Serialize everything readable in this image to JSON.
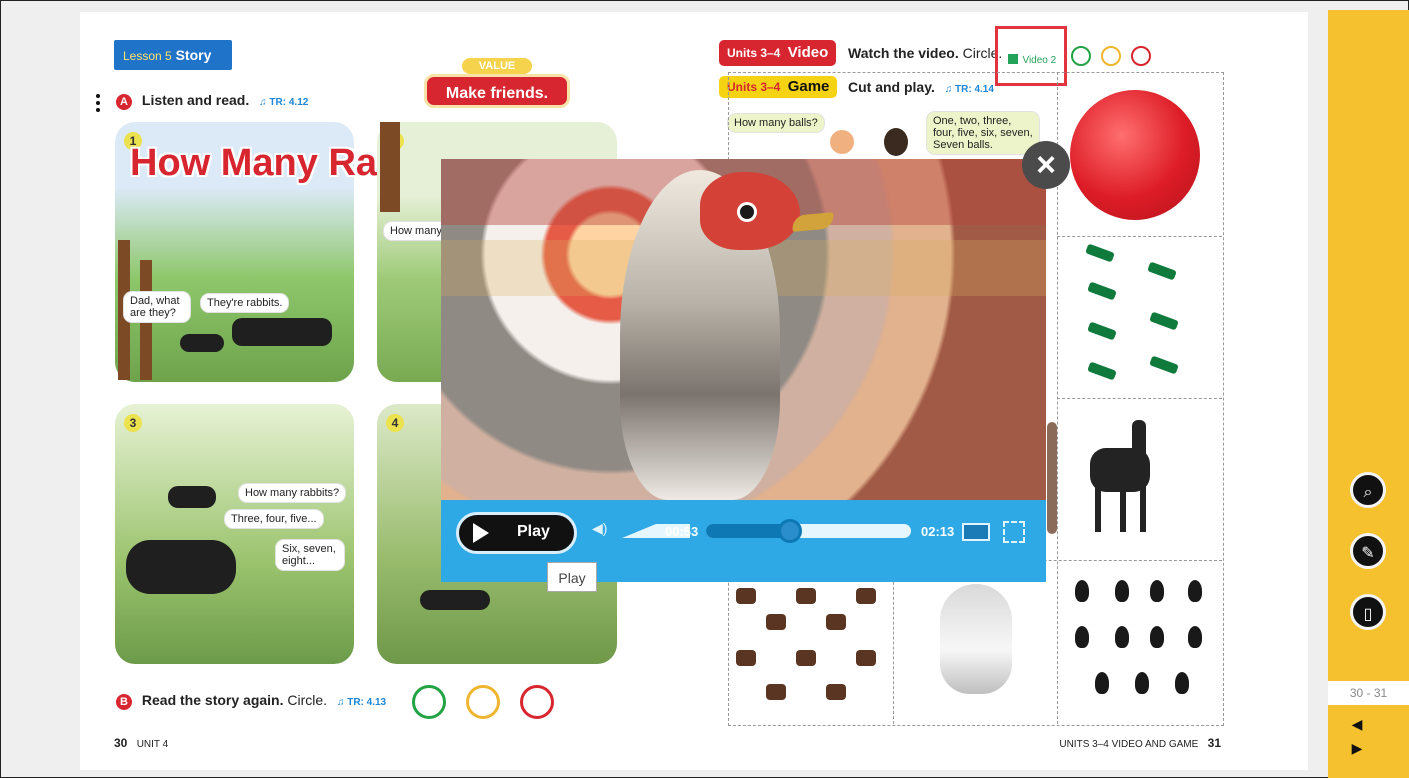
{
  "lesson": {
    "prefix": "Lesson 5",
    "title": "Story"
  },
  "value": {
    "tag": "VALUE",
    "text": "Make friends."
  },
  "section_a": {
    "badge": "A",
    "text": "Listen and read.",
    "track": "TR: 4.12"
  },
  "section_b": {
    "badge": "B",
    "text_bold": "Read the story again.",
    "text_rest": "Circle.",
    "track": "TR: 4.13"
  },
  "panels": {
    "p1": {
      "number": "1",
      "title": "How Many Rabbits?",
      "bubble1": "Dad, what are they?",
      "bubble2": "They're rabbits."
    },
    "p2": {
      "number": "2",
      "bubble": "How many"
    },
    "p3": {
      "number": "3",
      "bubble1": "How many rabbits?",
      "bubble2": "Three, four, five...",
      "bubble3": "Six, seven, eight..."
    },
    "p4": {
      "number": "4"
    }
  },
  "right_page": {
    "video_pill_prefix": "Units 3–4",
    "video_pill_title": "Video",
    "video_text_bold": "Watch the video.",
    "video_text_rest": "Circle.",
    "video_link": "Video 2",
    "game_pill_prefix": "Units 3–4",
    "game_pill_title": "Game",
    "game_text_bold": "Cut and play.",
    "game_track": "TR: 4.14",
    "bubble_left": "How many balls?",
    "bubble_right": "One, two, three, four, five, six, seven, Seven balls."
  },
  "video_player": {
    "play_label": "Play",
    "tooltip": "Play",
    "current_time": "00:53",
    "duration": "02:13",
    "progress": 0.4,
    "close_label": "×"
  },
  "footer": {
    "left_page": "30",
    "left_unit": "UNIT 4",
    "right_text": "UNITS 3–4 VIDEO AND GAME",
    "right_page": "31"
  },
  "sidebar": {
    "zoom_icon": "zoom-icon",
    "pen_icon": "pen-icon",
    "page_icon": "page-icon",
    "page_range": "30 - 31",
    "prev": "◀",
    "next": "▶"
  },
  "colors": {
    "sidebar": "#f6c12f",
    "player_bar": "#2ea9e6",
    "lesson_badge": "#1f73c8",
    "accent_red": "#d7262f"
  }
}
